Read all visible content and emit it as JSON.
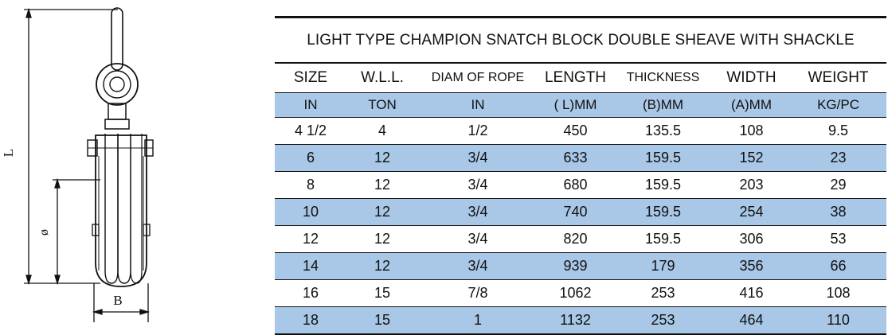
{
  "drawing": {
    "dimension_labels": {
      "length": "L",
      "diameter": "ø",
      "thickness": "B"
    }
  },
  "table": {
    "title": "LIGHT TYPE CHAMPION SNATCH BLOCK DOUBLE SHEAVE WITH SHACKLE",
    "headers": [
      "SIZE",
      "W.L.L.",
      "DIAM OF ROPE",
      "LENGTH",
      "THICKNESS",
      "WIDTH",
      "WEIGHT"
    ],
    "units": [
      "IN",
      "TON",
      "IN",
      "( L)MM",
      "(B)MM",
      "(A)MM",
      "KG/PC"
    ],
    "rows": [
      [
        "4 1/2",
        "4",
        "1/2",
        "450",
        "135.5",
        "108",
        "9.5"
      ],
      [
        "6",
        "12",
        "3/4",
        "633",
        "159.5",
        "152",
        "23"
      ],
      [
        "8",
        "12",
        "3/4",
        "680",
        "159.5",
        "203",
        "29"
      ],
      [
        "10",
        "12",
        "3/4",
        "740",
        "159.5",
        "254",
        "38"
      ],
      [
        "12",
        "12",
        "3/4",
        "820",
        "159.5",
        "306",
        "53"
      ],
      [
        "14",
        "12",
        "3/4",
        "939",
        "179",
        "356",
        "66"
      ],
      [
        "16",
        "15",
        "7/8",
        "1062",
        "253",
        "416",
        "108"
      ],
      [
        "18",
        "15",
        "1",
        "1132",
        "253",
        "464",
        "110"
      ]
    ]
  },
  "colors": {
    "band": "#a9c7e6",
    "line": "#111111"
  }
}
